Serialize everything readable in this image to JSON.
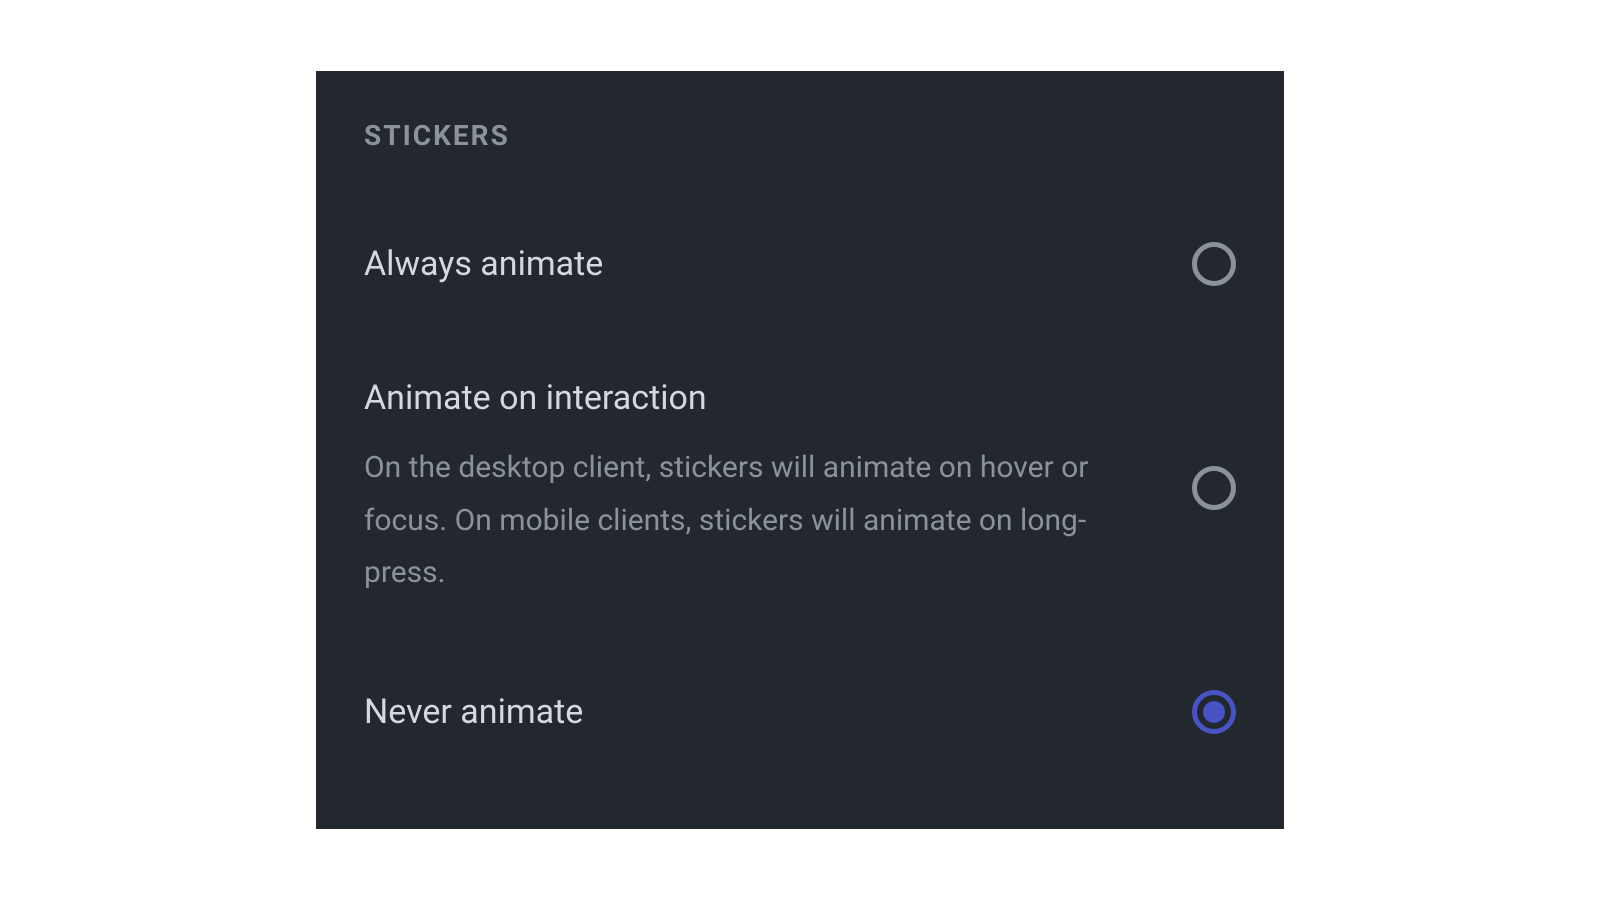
{
  "section": {
    "title": "STICKERS"
  },
  "options": [
    {
      "label": "Always animate",
      "description": "",
      "selected": false
    },
    {
      "label": "Animate on interaction",
      "description": "On the desktop client, stickers will animate on hover or focus. On mobile clients, stickers will animate on long-press.",
      "selected": false
    },
    {
      "label": "Never animate",
      "description": "",
      "selected": true
    }
  ]
}
